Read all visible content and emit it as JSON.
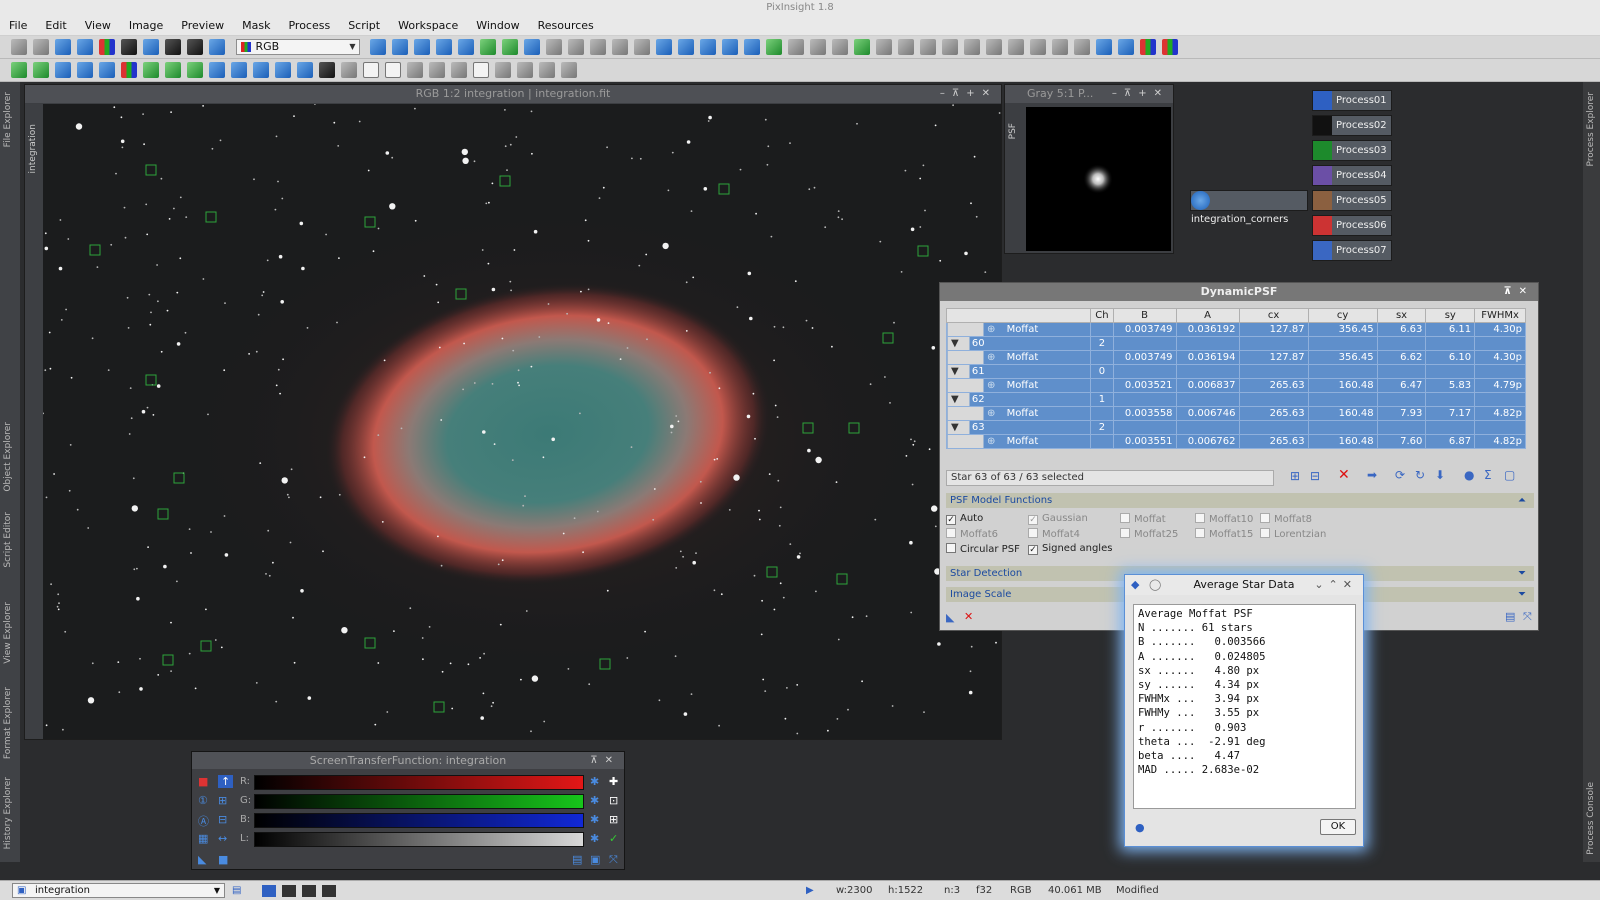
{
  "app": {
    "title": "PixInsight 1.8"
  },
  "menu": [
    "File",
    "Edit",
    "View",
    "Image",
    "Preview",
    "Mask",
    "Process",
    "Script",
    "Workspace",
    "Window",
    "Resources"
  ],
  "toolbar": {
    "channel_select": "RGB"
  },
  "left_tabs": [
    "File Explorer",
    "Object Explorer",
    "Script Editor",
    "View Explorer",
    "Format Explorer",
    "History Explorer"
  ],
  "right_tabs": [
    "Process Explorer",
    "Process Console"
  ],
  "image_window": {
    "title": "RGB 1:2 integration | integration.fit",
    "side_tab": "integration"
  },
  "psf_window": {
    "title": "Gray 5:1 P...",
    "side_tab": "PSF"
  },
  "process_icons": [
    "Process01",
    "Process02",
    "Process03",
    "Process04",
    "Process05",
    "Process06",
    "Process07"
  ],
  "image_icon": "integration_corners",
  "dynamic_psf": {
    "title": "DynamicPSF",
    "columns": [
      "",
      "Ch",
      "B",
      "A",
      "cx",
      "cy",
      "sx",
      "sy",
      "FWHMx"
    ],
    "rows": [
      {
        "kind": "model",
        "name": "Moffat",
        "ch": "",
        "B": "0.003749",
        "A": "0.036192",
        "cx": "127.87",
        "cy": "356.45",
        "sx": "6.63",
        "sy": "6.11",
        "fwhmx": "4.30p"
      },
      {
        "kind": "star",
        "name": "60",
        "ch": "2",
        "B": "",
        "A": "",
        "cx": "",
        "cy": "",
        "sx": "",
        "sy": "",
        "fwhmx": ""
      },
      {
        "kind": "model",
        "name": "Moffat",
        "ch": "",
        "B": "0.003749",
        "A": "0.036194",
        "cx": "127.87",
        "cy": "356.45",
        "sx": "6.62",
        "sy": "6.10",
        "fwhmx": "4.30p"
      },
      {
        "kind": "star",
        "name": "61",
        "ch": "0",
        "B": "",
        "A": "",
        "cx": "",
        "cy": "",
        "sx": "",
        "sy": "",
        "fwhmx": ""
      },
      {
        "kind": "model",
        "name": "Moffat",
        "ch": "",
        "B": "0.003521",
        "A": "0.006837",
        "cx": "265.63",
        "cy": "160.48",
        "sx": "6.47",
        "sy": "5.83",
        "fwhmx": "4.79p"
      },
      {
        "kind": "star",
        "name": "62",
        "ch": "1",
        "B": "",
        "A": "",
        "cx": "",
        "cy": "",
        "sx": "",
        "sy": "",
        "fwhmx": ""
      },
      {
        "kind": "model",
        "name": "Moffat",
        "ch": "",
        "B": "0.003558",
        "A": "0.006746",
        "cx": "265.63",
        "cy": "160.48",
        "sx": "7.93",
        "sy": "7.17",
        "fwhmx": "4.82p"
      },
      {
        "kind": "star",
        "name": "63",
        "ch": "2",
        "B": "",
        "A": "",
        "cx": "",
        "cy": "",
        "sx": "",
        "sy": "",
        "fwhmx": ""
      },
      {
        "kind": "model",
        "name": "Moffat",
        "ch": "",
        "B": "0.003551",
        "A": "0.006762",
        "cx": "265.63",
        "cy": "160.48",
        "sx": "7.60",
        "sy": "6.87",
        "fwhmx": "4.82p"
      }
    ],
    "status": "Star    63 of    63 / 63 selected",
    "section_psf": "PSF Model Functions",
    "section_detection": "Star Detection",
    "section_scale": "Image Scale",
    "checkboxes": [
      {
        "label": "Auto",
        "checked": true,
        "enabled": true
      },
      {
        "label": "Gaussian",
        "checked": true,
        "enabled": false
      },
      {
        "label": "Moffat",
        "checked": false,
        "enabled": false
      },
      {
        "label": "Moffat10",
        "checked": false,
        "enabled": false
      },
      {
        "label": "Moffat8",
        "checked": false,
        "enabled": false
      },
      {
        "label": "Moffat6",
        "checked": false,
        "enabled": false
      },
      {
        "label": "Moffat4",
        "checked": false,
        "enabled": false
      },
      {
        "label": "Moffat25",
        "checked": false,
        "enabled": false
      },
      {
        "label": "Moffat15",
        "checked": false,
        "enabled": false
      },
      {
        "label": "Lorentzian",
        "checked": false,
        "enabled": false
      },
      {
        "label": "Circular PSF",
        "checked": false,
        "enabled": true
      },
      {
        "label": "Signed angles",
        "checked": true,
        "enabled": true
      }
    ]
  },
  "stf": {
    "title": "ScreenTransferFunction: integration",
    "channels": [
      "R:",
      "G:",
      "B:",
      "L:"
    ]
  },
  "average_star": {
    "title": "Average Star Data",
    "lines": [
      "Average Moffat PSF",
      "N ....... 61 stars",
      "B .......   0.003566",
      "A .......   0.024805",
      "sx ......   4.80 px",
      "sy ......   4.34 px",
      "FWHMx ...   3.94 px",
      "FWHMy ...   3.55 px",
      "r .......   0.903",
      "theta ...  -2.91 deg",
      "beta ....   4.47",
      "MAD ..... 2.683e-02"
    ],
    "ok": "OK"
  },
  "status_bar": {
    "view": "integration",
    "width": "w:2300",
    "height": "h:1522",
    "channels": "n:3",
    "format": "f32",
    "colorspace": "RGB",
    "size": "40.061 MB",
    "state": "Modified"
  },
  "colors": {
    "selection": "#5f8fcb",
    "nebula": "#d04f45",
    "core": "#3f7a76"
  }
}
